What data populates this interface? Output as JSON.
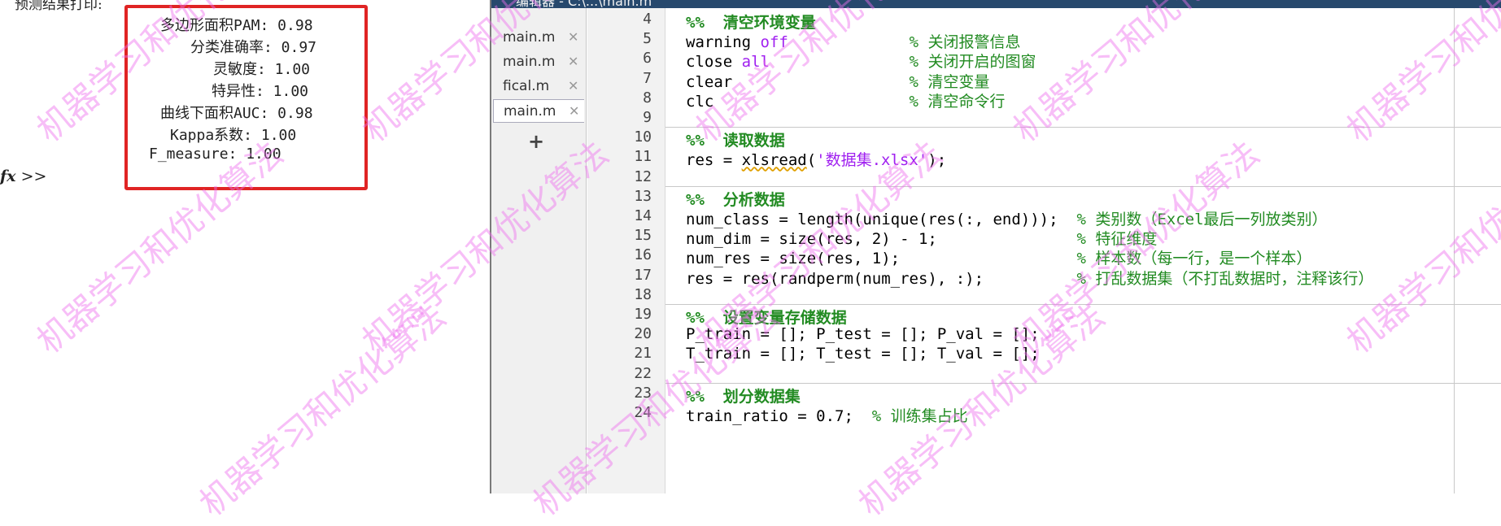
{
  "command_window": {
    "header_text": "预测结果打印:",
    "metrics": [
      "多边形面积PAM: 0.98",
      "分类准确率: 0.97",
      "灵敏度: 1.00",
      "特异性: 1.00",
      "曲线下面积AUC: 0.98",
      "Kappa系数: 1.00",
      "F_measure: 1.00"
    ],
    "prompt_fx": "fx",
    "prompt": ">>"
  },
  "editor": {
    "title": "编辑器 - C:\\...\\main.m",
    "tabs": [
      {
        "label": "main.m",
        "active": false
      },
      {
        "label": "main.m",
        "active": false
      },
      {
        "label": "fical.m",
        "active": false
      },
      {
        "label": "main.m",
        "active": true
      }
    ],
    "add_tab_label": "+",
    "close_glyph": "✕",
    "lines": [
      {
        "n": "4",
        "parts": [
          {
            "t": "%%  清空环境变量",
            "c": "sec"
          }
        ]
      },
      {
        "n": "5",
        "parts": [
          {
            "t": "warning ",
            "c": ""
          },
          {
            "t": "off",
            "c": "kw"
          },
          {
            "t": "             ",
            "c": ""
          },
          {
            "t": "% 关闭报警信息",
            "c": "cm"
          }
        ]
      },
      {
        "n": "6",
        "parts": [
          {
            "t": "close ",
            "c": ""
          },
          {
            "t": "all",
            "c": "kw"
          },
          {
            "t": "               ",
            "c": ""
          },
          {
            "t": "% 关闭开启的图窗",
            "c": "cm"
          }
        ]
      },
      {
        "n": "7",
        "parts": [
          {
            "t": "clear                   ",
            "c": ""
          },
          {
            "t": "% 清空变量",
            "c": "cm"
          }
        ]
      },
      {
        "n": "8",
        "parts": [
          {
            "t": "clc                     ",
            "c": ""
          },
          {
            "t": "% 清空命令行",
            "c": "cm"
          }
        ]
      },
      {
        "n": "9",
        "parts": []
      },
      {
        "n": "10",
        "parts": [
          {
            "t": "%%  读取数据",
            "c": "sec"
          }
        ]
      },
      {
        "n": "11",
        "parts": [
          {
            "t": "res = ",
            "c": ""
          },
          {
            "t": "xlsread",
            "c": "fn"
          },
          {
            "t": "(",
            "c": ""
          },
          {
            "t": "'数据集.xlsx'",
            "c": "st"
          },
          {
            "t": ");",
            "c": ""
          }
        ]
      },
      {
        "n": "12",
        "parts": []
      },
      {
        "n": "13",
        "parts": [
          {
            "t": "%%  分析数据",
            "c": "sec"
          }
        ]
      },
      {
        "n": "14",
        "parts": [
          {
            "t": "num_class = length(unique(res(:, end)));  ",
            "c": ""
          },
          {
            "t": "% 类别数（Excel最后一列放类别）",
            "c": "cm"
          }
        ]
      },
      {
        "n": "15",
        "parts": [
          {
            "t": "num_dim = size(res, 2) - 1;               ",
            "c": ""
          },
          {
            "t": "% 特征维度",
            "c": "cm"
          }
        ]
      },
      {
        "n": "16",
        "parts": [
          {
            "t": "num_res = size(res, 1);                   ",
            "c": ""
          },
          {
            "t": "% 样本数（每一行，是一个样本）",
            "c": "cm"
          }
        ]
      },
      {
        "n": "17",
        "parts": [
          {
            "t": "res = res(randperm(num_res), :);          ",
            "c": ""
          },
          {
            "t": "% 打乱数据集（不打乱数据时，注释该行）",
            "c": "cm"
          }
        ]
      },
      {
        "n": "18",
        "parts": []
      },
      {
        "n": "19",
        "parts": [
          {
            "t": "%%  设置变量存储数据",
            "c": "sec"
          }
        ]
      },
      {
        "n": "20",
        "parts": [
          {
            "t": "P_train = []; P_test = []; P_val = [];",
            "c": ""
          }
        ]
      },
      {
        "n": "21",
        "parts": [
          {
            "t": "T_train = []; T_test = []; T_val = [];",
            "c": ""
          }
        ]
      },
      {
        "n": "22",
        "parts": []
      },
      {
        "n": "23",
        "parts": [
          {
            "t": "%%  划分数据集",
            "c": "sec"
          }
        ]
      },
      {
        "n": "24",
        "parts": [
          {
            "t": "train_ratio = 0.7;  ",
            "c": ""
          },
          {
            "t": "% 训练集占比",
            "c": "cm"
          }
        ]
      }
    ]
  },
  "watermark": "机器学习和优化算法"
}
